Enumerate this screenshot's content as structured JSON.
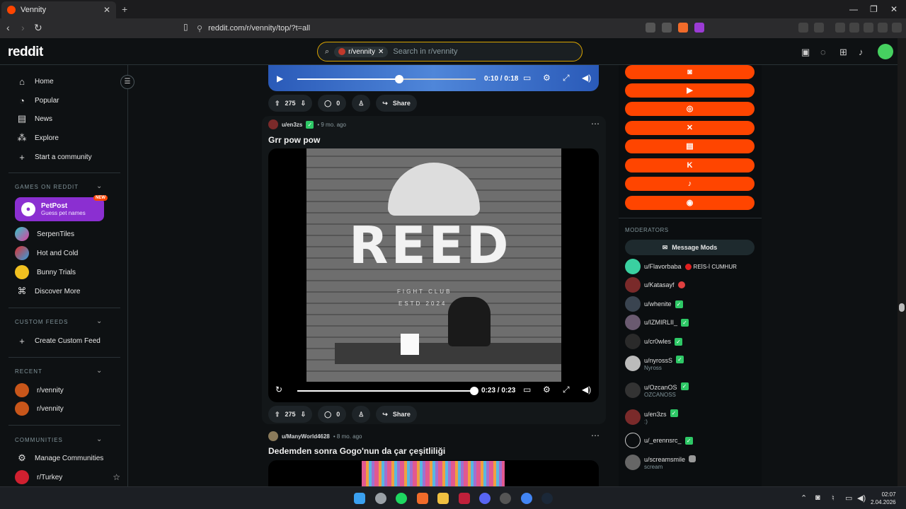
{
  "browser": {
    "tab_title": "Vennity",
    "url": "reddit.com/r/vennity/top/?t=all"
  },
  "header": {
    "logo": "reddit",
    "search_chip": "r/vennity",
    "search_placeholder": "Search in r/vennity"
  },
  "sidebar": {
    "main": [
      {
        "label": "Home",
        "icon": "home-icon"
      },
      {
        "label": "Popular",
        "icon": "popular-icon"
      },
      {
        "label": "News",
        "icon": "news-icon"
      },
      {
        "label": "Explore",
        "icon": "explore-icon"
      },
      {
        "label": "Start a community",
        "icon": "plus-icon"
      }
    ],
    "games_label": "GAMES ON REDDIT",
    "petpost": {
      "title": "PetPost",
      "subtitle": "Guess pet names",
      "badge": "NEW"
    },
    "games": [
      "SerpenTiles",
      "Hot and Cold",
      "Bunny Trials",
      "Discover More"
    ],
    "custom_feeds_label": "CUSTOM FEEDS",
    "create_custom_feed": "Create Custom Feed",
    "recent_label": "RECENT",
    "recent": [
      "r/vennity",
      "r/vennity"
    ],
    "communities_label": "COMMUNITIES",
    "manage_communities": "Manage Communities",
    "community": "r/Turkey"
  },
  "feed": {
    "top_player": {
      "time": "0:10 / 0:18",
      "progress": 0.57
    },
    "post1_actions": {
      "votes": "275",
      "comments": "0",
      "share": "Share"
    },
    "post2": {
      "user": "u/en3zs",
      "age": "9 mo. ago",
      "title": "Grr pow pow",
      "time": "0:23 / 0:23",
      "progress": 1.0,
      "votes": "275",
      "comments": "0",
      "share": "Share",
      "video_text": "REED",
      "video_sub1": "FIGHT CLUB",
      "video_sub2": "ESTD 2024"
    },
    "post3": {
      "user": "u/ManyWorld4628",
      "age": "8 mo. ago",
      "title": "Dedemden sonra Gogo'nun da çar çeşitliliği"
    }
  },
  "right": {
    "social_buttons": [
      "discord",
      "youtube",
      "instagram",
      "x",
      "twitch",
      "kick",
      "tiktok",
      "steam"
    ],
    "moderators_label": "MODERATORS",
    "message_mods": "Message Mods",
    "mods": [
      {
        "name": "u/Flavorbaba",
        "flair": "REİS-İ CUMHUR",
        "color": "#3ad0a0"
      },
      {
        "name": "u/Katasayf",
        "flair": "",
        "color": "#7a2a2a"
      },
      {
        "name": "u/whenite",
        "flair": "",
        "color": "#3a4450"
      },
      {
        "name": "u/IZMIRLII_",
        "flair": "",
        "color": "#6a5a70"
      },
      {
        "name": "u/cr0wles",
        "flair": "",
        "color": "#2a2a2a"
      },
      {
        "name": "u/nyrossS",
        "flair": "",
        "sub": "Nyross",
        "color": "#bbbbbb"
      },
      {
        "name": "u/OzcanOS",
        "flair": "",
        "sub": "OZCANOSS",
        "color": "#333333"
      },
      {
        "name": "u/en3zs",
        "flair": "",
        "sub": ":)",
        "color": "#7a2a2a"
      },
      {
        "name": "u/_erennsrc_",
        "flair": "",
        "color": "#0b0e10"
      },
      {
        "name": "u/screamsmile",
        "flair": "",
        "sub": "scream",
        "color": "#666666"
      }
    ]
  },
  "taskbar": {
    "time": "02:07",
    "date": "2.04.2026"
  }
}
